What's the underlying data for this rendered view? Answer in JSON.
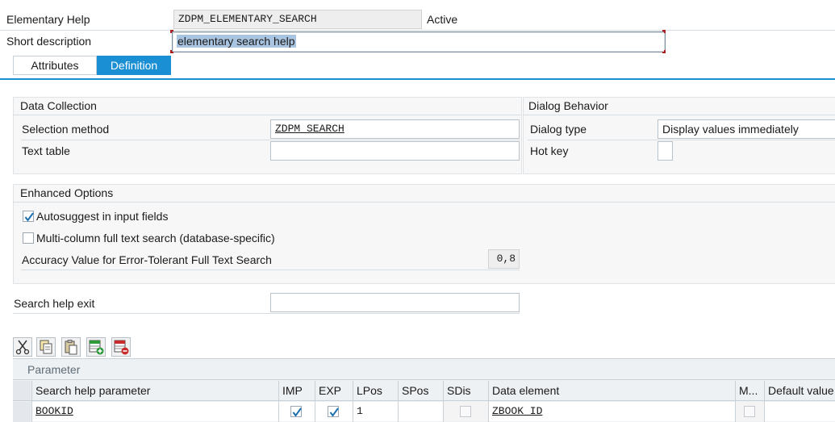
{
  "header": {
    "elementary_help_label": "Elementary Help",
    "elementary_help_value": "ZDPM_ELEMENTARY_SEARCH",
    "status": "Active",
    "short_description_label": "Short description",
    "short_description_value": "elementary search help"
  },
  "tabs": [
    {
      "label": "Attributes",
      "active": false
    },
    {
      "label": "Definition",
      "active": true
    }
  ],
  "data_collection": {
    "title": "Data Collection",
    "selection_method_label": "Selection method",
    "selection_method_value": "ZDPM_SEARCH",
    "text_table_label": "Text table",
    "text_table_value": ""
  },
  "dialog_behavior": {
    "title": "Dialog Behavior",
    "dialog_type_label": "Dialog type",
    "dialog_type_value": "Display values immediately",
    "hot_key_label": "Hot key",
    "hot_key_value": ""
  },
  "enhanced_options": {
    "title": "Enhanced Options",
    "autosuggest_label": "Autosuggest in input fields",
    "autosuggest_checked": true,
    "multicolumn_label": "Multi-column full text search (database-specific)",
    "multicolumn_checked": false,
    "accuracy_label": "Accuracy Value for Error-Tolerant Full Text Search",
    "accuracy_value": "0,8"
  },
  "exit": {
    "label": "Search help exit",
    "value": ""
  },
  "toolbar": {
    "icons": [
      "cut-icon",
      "copy-icon",
      "paste-icon",
      "insert-row-icon",
      "delete-row-icon"
    ]
  },
  "parameter_table": {
    "title": "Parameter",
    "columns": [
      "Search help parameter",
      "IMP",
      "EXP",
      "LPos",
      "SPos",
      "SDis",
      "Data element",
      "M...",
      "Default value"
    ],
    "rows": [
      {
        "search_help_parameter": "BOOKID",
        "imp": true,
        "exp": true,
        "lpos": "1",
        "spos": "",
        "sdis": false,
        "data_element": "ZBOOK_ID",
        "m": false,
        "default_value": ""
      }
    ]
  },
  "colors": {
    "accent": "#1a8fd4",
    "selection": "#a9c4e0",
    "group_bg": "#f7f7f7",
    "check": "#1a6fb0"
  }
}
